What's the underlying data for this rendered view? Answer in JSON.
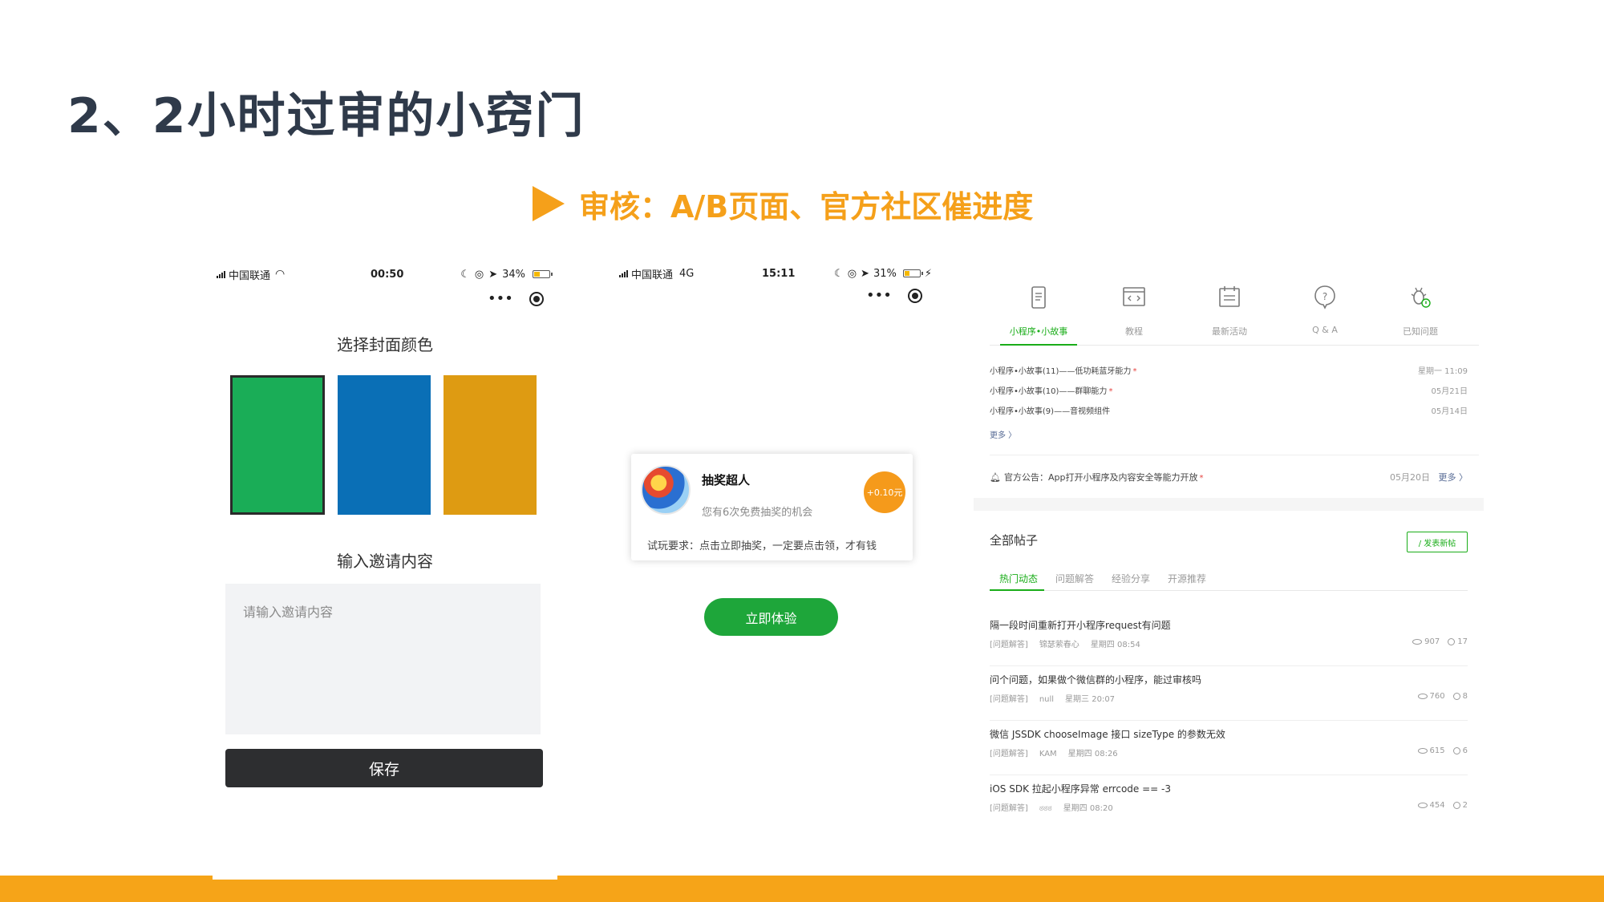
{
  "slide": {
    "title": "2、2小时过审的小窍门",
    "subtitle": "审核：A/B页面、官方社区催进度"
  },
  "phone_a": {
    "status": {
      "carrier": "中国联通",
      "time": "00:50",
      "battery": "34%"
    },
    "capsule": {
      "more": "•••"
    },
    "color_section_title": "选择封面颜色",
    "swatches": [
      "#1aad57",
      "#0a6fb6",
      "#de9b12"
    ],
    "invite_section_title": "输入邀请内容",
    "invite_placeholder": "请输入邀请内容",
    "save_label": "保存"
  },
  "phone_b": {
    "status": {
      "carrier": "中国联通",
      "network": "4G",
      "time": "15:11",
      "battery": "31%"
    },
    "capsule": {
      "more": "•••"
    },
    "card": {
      "name": "抽奖超人",
      "desc": "您有6次免费抽奖的机会",
      "badge": "+0.10元",
      "requirement": "试玩要求：点击立即抽奖，一定要点击领，才有钱"
    },
    "try_label": "立即体验"
  },
  "community": {
    "nav": [
      {
        "label": "小程序•小故事",
        "icon": "phone-doc-icon"
      },
      {
        "label": "教程",
        "icon": "code-window-icon"
      },
      {
        "label": "最新活动",
        "icon": "calendar-list-icon"
      },
      {
        "label": "Q & A",
        "icon": "question-bubble-icon"
      },
      {
        "label": "已知问题",
        "icon": "bug-icon"
      }
    ],
    "stories": [
      {
        "title": "小程序•小故事(11)——低功耗蓝牙能力",
        "date": "星期一 11:09",
        "new": true
      },
      {
        "title": "小程序•小故事(10)——群聊能力",
        "date": "05月21日",
        "new": true
      },
      {
        "title": "小程序•小故事(9)——音视频组件",
        "date": "05月14日",
        "new": false
      }
    ],
    "stories_more": "更多 〉",
    "announcement": {
      "text": "官方公告：App打开小程序及内容安全等能力开放",
      "date": "05月20日",
      "more": "更多 〉"
    },
    "all_posts_title": "全部帖子",
    "new_post_label": "/ 发表新帖",
    "post_tabs": [
      "热门动态",
      "问题解答",
      "经验分享",
      "开源推荐"
    ],
    "posts": [
      {
        "title": "隔一段时间重新打开小程序request有问题",
        "tag": "[问题解答]",
        "author": "锦瑟萦春心",
        "time": "星期四 08:54",
        "views": "907",
        "comments": "17"
      },
      {
        "title": "问个问题，如果做个微信群的小程序，能过审核吗",
        "tag": "[问题解答]",
        "author": "null",
        "time": "星期三 20:07",
        "views": "760",
        "comments": "8"
      },
      {
        "title": "微信 JSSDK chooseImage 接口 sizeType 的参数无效",
        "tag": "[问题解答]",
        "author": "KAM",
        "time": "星期四 08:26",
        "views": "615",
        "comments": "6"
      },
      {
        "title": "iOS SDK 拉起小程序异常 errcode == -3",
        "tag": "[问题解答]",
        "author": "ಠಠಠ",
        "time": "星期四 08:20",
        "views": "454",
        "comments": "2"
      }
    ]
  },
  "colors": {
    "accent": "#f6a418",
    "wechat_green": "#1aad19",
    "title": "#2f3a4a"
  }
}
